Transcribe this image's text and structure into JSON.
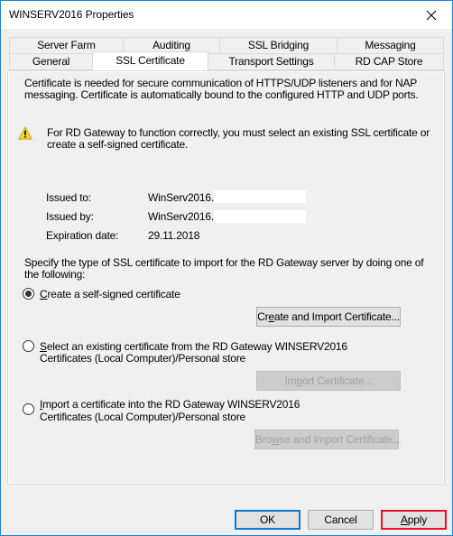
{
  "window": {
    "title": "WINSERV2016 Properties",
    "close_icon": "close-icon"
  },
  "tabs": {
    "row_back": [
      {
        "label": "Server Farm"
      },
      {
        "label": "Auditing"
      },
      {
        "label": "SSL Bridging"
      },
      {
        "label": "Messaging"
      }
    ],
    "row_front": [
      {
        "label": "General"
      },
      {
        "label": "SSL Certificate",
        "active": true
      },
      {
        "label": "Transport Settings"
      },
      {
        "label": "RD CAP Store"
      }
    ]
  },
  "panel": {
    "intro_line1": "Certificate is needed for secure communication of HTTPS/UDP listeners and for NAP",
    "intro_line2": "messaging. Certificate is automatically bound to the configured HTTP and UDP ports.",
    "warning_icon": "warning-icon",
    "warning_line1": "For RD Gateway to function correctly, you must select an existing SSL certificate or",
    "warning_line2": "create a self-signed certificate.",
    "cert": {
      "issued_to_label": "Issued to:",
      "issued_to_value": "WinServ2016.",
      "issued_by_label": "Issued by:",
      "issued_by_value": "WinServ2016.",
      "expiration_label": "Expiration date:",
      "expiration_value": "29.11.2018"
    },
    "specify_line1": "Specify the type of SSL certificate to import for the RD Gateway server by doing one of",
    "specify_line2": "the following:",
    "options": [
      {
        "mnemonic": "C",
        "label_rest": "reate a self-signed certificate",
        "line2": "",
        "checked": true,
        "button_pre": "Cr",
        "button_mnemonic": "e",
        "button_post": "ate and Import Certificate...",
        "button_enabled": true
      },
      {
        "mnemonic": "S",
        "label_rest": "elect an existing certificate from the RD Gateway WINSERV2016",
        "line2": "Certificates (Local Computer)/Personal store",
        "checked": false,
        "button_pre": "Im",
        "button_mnemonic": "p",
        "button_post": "ort Certificate...",
        "button_enabled": false
      },
      {
        "mnemonic": "I",
        "label_rest": "mport a certificate into the RD Gateway WINSERV2016",
        "line2": "Certificates (Local Computer)/Personal store",
        "checked": false,
        "button_pre": "Bro",
        "button_mnemonic": "w",
        "button_post": "se and Import Certificate...",
        "button_enabled": false
      }
    ]
  },
  "footer": {
    "ok_label": "OK",
    "cancel_label": "Cancel",
    "apply_mnemonic": "A",
    "apply_rest": "pply",
    "highlight_color": "#e81123",
    "accent_color": "#0078d7"
  }
}
